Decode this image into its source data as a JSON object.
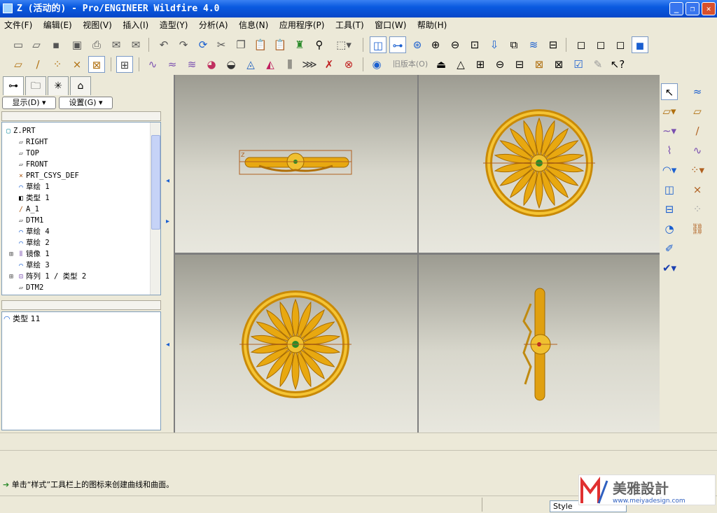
{
  "window": {
    "title": "Z (活动的) - Pro/ENGINEER Wildfire 4.0",
    "minimize": "_",
    "restore": "❐",
    "close": "✕"
  },
  "menu": [
    "文件(F)",
    "编辑(E)",
    "视图(V)",
    "插入(I)",
    "造型(Y)",
    "分析(A)",
    "信息(N)",
    "应用程序(P)",
    "工具(T)",
    "窗口(W)",
    "帮助(H)"
  ],
  "toolbar": {
    "old_version_label": "旧版本(O)"
  },
  "panel": {
    "show_label": "显示(D) ▾",
    "settings_label": "设置(G) ▾"
  },
  "tree": [
    {
      "label": "Z.PRT",
      "icon": "part-icon"
    },
    {
      "label": "RIGHT",
      "icon": "datum-plane-icon"
    },
    {
      "label": "TOP",
      "icon": "datum-plane-icon"
    },
    {
      "label": "FRONT",
      "icon": "datum-plane-icon"
    },
    {
      "label": "PRT_CSYS_DEF",
      "icon": "csys-icon"
    },
    {
      "label": "草绘 1",
      "icon": "sketch-icon"
    },
    {
      "label": "类型 1",
      "icon": "style-feature-icon"
    },
    {
      "label": "A_1",
      "icon": "datum-axis-icon"
    },
    {
      "label": "DTM1",
      "icon": "datum-plane-icon"
    },
    {
      "label": "草绘 4",
      "icon": "sketch-icon"
    },
    {
      "label": "草绘 2",
      "icon": "sketch-icon"
    },
    {
      "label": "镜像 1",
      "icon": "mirror-icon"
    },
    {
      "label": "草绘 3",
      "icon": "sketch-icon"
    },
    {
      "label": "阵列 1 / 类型 2",
      "icon": "pattern-icon"
    },
    {
      "label": "DTM2",
      "icon": "datum-plane-icon"
    }
  ],
  "style_tree": {
    "item": "类型 11"
  },
  "message": "单击“样式”工具栏上的图标来创建曲线和曲面。",
  "status": {
    "filter": "Style"
  },
  "logo": {
    "cn": "美雅設計",
    "url": "www.meiyadesign.com"
  },
  "colors": {
    "model": "#e0a010",
    "title_bar": "#0a5ae0",
    "viewport_bg": "#dcdbd0"
  }
}
